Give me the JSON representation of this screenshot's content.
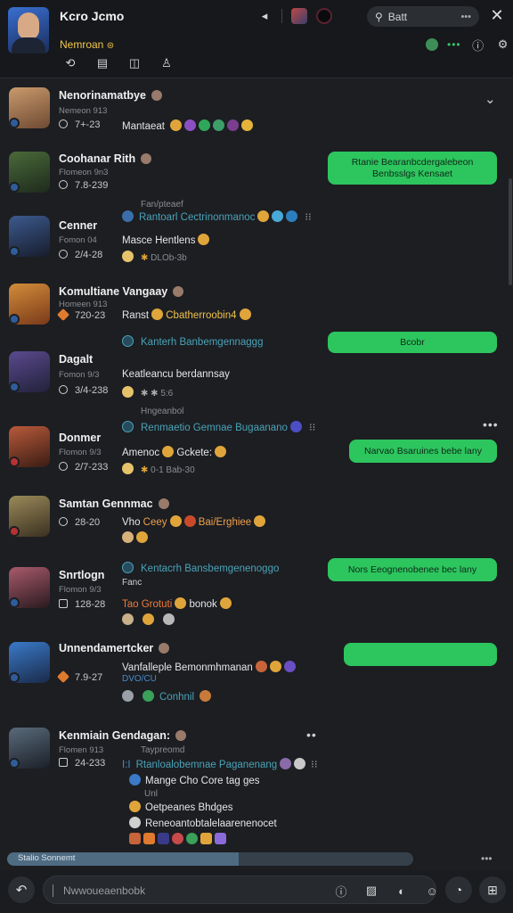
{
  "header": {
    "title": "Kcro Jcmo",
    "subtitle": "Nemroan",
    "search_label": "Batt",
    "icons": [
      "avatar-icon",
      "play-icon",
      "back-icon",
      "bookmark-icon",
      "grid-icon",
      "user-icon",
      "settings-icon",
      "info-icon",
      "more-icon",
      "close-icon"
    ]
  },
  "messages": [
    {
      "name": "Nenorinamatbye",
      "meta": "Nemeon 913",
      "time": "7+-23",
      "line1": "Mantaeat",
      "bubble": ""
    },
    {
      "name": "Coohanar Rith",
      "meta": "Flomeon 9n3",
      "time": "7.8-239",
      "line1": "",
      "bubble": "Rtanie Bearanbcdergalebeon Benbsslgs Kensaet"
    },
    {
      "name": "Cenner",
      "meta": "Fomon 04",
      "time": "2/4-28",
      "reply_label": "Fan/pteaef",
      "reply": "Rantoarl Cectrinonmanoc",
      "line1": "Masce Hentlens",
      "line2": "DLOb-3b",
      "bubble": ""
    },
    {
      "name": "Komultiane Vangaay",
      "meta": "Homeen 913",
      "time": "720-23",
      "line1": "Ranst",
      "line1b": "Cbatherroobin4",
      "reply": "Kanterh Banbemgennaggg",
      "bubble": "Bcobr"
    },
    {
      "name": "Dagalt",
      "meta": "Fomon 9/3",
      "time": "3/4-238",
      "line1": "Keatleancu berdannsay",
      "line2": "5:6",
      "bubble": ""
    },
    {
      "name": "Donmer",
      "meta": "Flomon 9/3",
      "time": "2/7-233",
      "reply_label": "Hngeanbol",
      "reply": "Renmaetio Gemnae Bugaanano",
      "line1": "Amenoc",
      "line1b": "Gckete:",
      "line2": "0-1 Bab-30",
      "bubble": "Narvao Bsaruines bebe lany"
    },
    {
      "name": "Samtan Gennmac",
      "meta": "",
      "time": "28-20",
      "line1": "Vho",
      "line1b": "Ceey",
      "line1c": "Bai/Erghiee",
      "bubble": ""
    },
    {
      "name": "Snrtlogn",
      "meta": "Flomon 9/3",
      "time": "128-28",
      "reply": "Kentacrh Bansbemgenenoggo",
      "line0": "Fanc",
      "line1": "Tao Grotuti",
      "line1b": "bonok",
      "bubble": "Nors Eeognenobenee bec lany"
    },
    {
      "name": "Unnendamertcker",
      "meta": "",
      "time": "7.9-27",
      "line1": "Vanfalleple Bemonmhmanan",
      "line2": "DVO/CU",
      "line3": "Conhnil",
      "bubble": ""
    },
    {
      "name": "Kenmiain Gendagan:",
      "meta": "Flomen 913",
      "time": "24-233",
      "reply_label": "Taypreomd",
      "reply": "Rtanloalobemnae Paganenang",
      "line1": "Mange Cho Core tag ges",
      "line2": "Unl",
      "line3": "Oetpeanes Bhdges",
      "line4": "Reneoantobtalelaarenenocet",
      "bubble": ""
    }
  ],
  "progress": {
    "label": "Stalio Sonnemt",
    "value": 0.57
  },
  "composer": {
    "placeholder": "Nwwoueaenbobk"
  }
}
